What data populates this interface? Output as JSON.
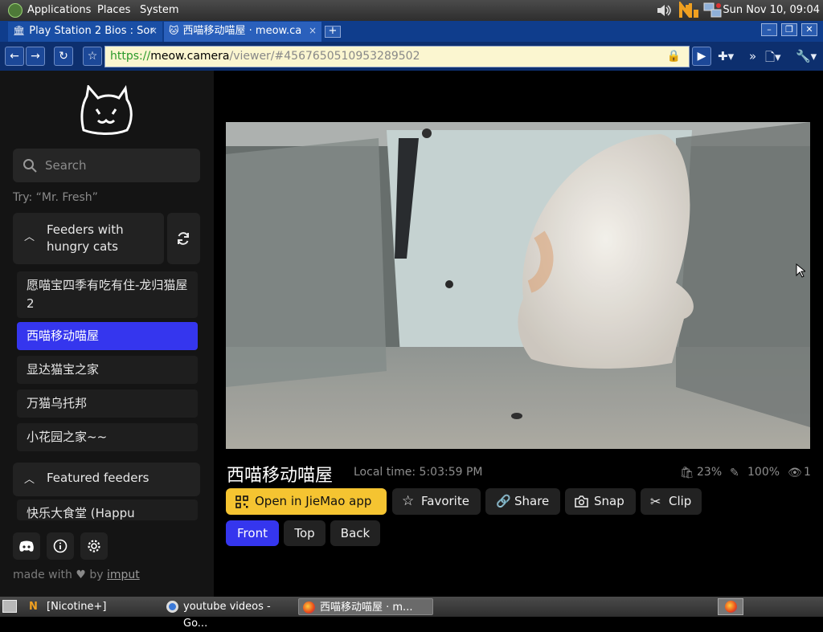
{
  "panel": {
    "menus": [
      "Applications",
      "Places",
      "System"
    ],
    "clock": "Sun Nov 10, 09:04"
  },
  "browser": {
    "tabs": [
      {
        "title": "Play Station 2 Bios : Sor"
      },
      {
        "title": "西喵移动喵屋 · meow.ca"
      }
    ],
    "url": {
      "scheme": "https://",
      "host": "meow.camera",
      "path": "/viewer/#4567650510953289502"
    }
  },
  "sidebar": {
    "search_placeholder": "Search",
    "hint": "Try: “Mr. Fresh”",
    "groups": [
      {
        "title": "Feeders with hungry cats"
      },
      {
        "title": "Featured feeders"
      }
    ],
    "feeders": [
      "愿喵宝四季有吃有住-龙归猫屋2",
      "西喵移动喵屋",
      "显达猫宝之家",
      "万猫乌托邦",
      "小花园之家~~"
    ],
    "featured": [
      "快乐大食堂 (Happu"
    ],
    "made_with": "made with",
    "by": "by",
    "author": "imput"
  },
  "viewer": {
    "title": "西喵移动喵屋",
    "local_time": "Local time: 5:03:59 PM",
    "food": "23%",
    "signal": "100%",
    "viewers": "1",
    "actions": [
      "Open in JieMao app",
      "Favorite",
      "Share",
      "Snap",
      "Clip"
    ],
    "views": [
      "Front",
      "Top",
      "Back"
    ]
  },
  "taskbar": {
    "items": [
      "[Nicotine+]",
      "youtube videos - Go...",
      "西喵移动喵屋 · m..."
    ]
  },
  "colors": {
    "accent": "#3536EE",
    "primary_button": "#F5C431"
  }
}
